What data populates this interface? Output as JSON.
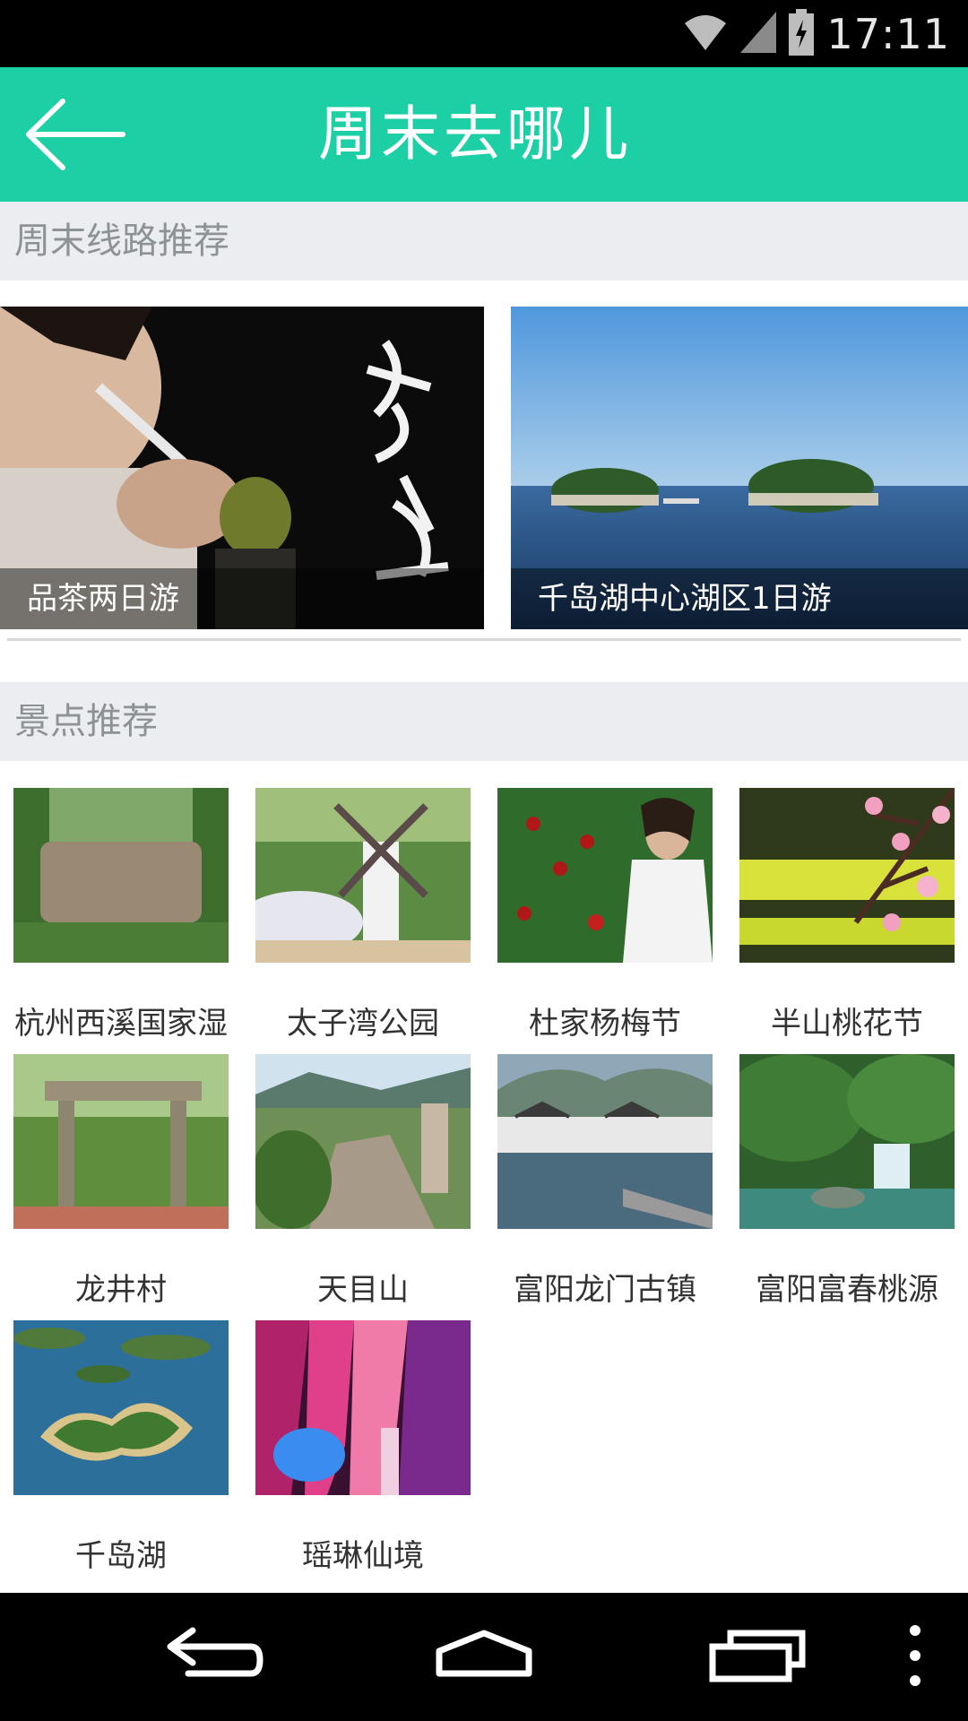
{
  "status_bar": {
    "time": "17:11"
  },
  "app_bar": {
    "title": "周末去哪儿"
  },
  "sections": {
    "routes_title": "周末线路推荐",
    "spots_title": "景点推荐"
  },
  "routes": [
    {
      "caption": "品茶两日游"
    },
    {
      "caption": "千岛湖中心湖区1日游"
    }
  ],
  "spots": [
    {
      "name": "杭州西溪国家湿"
    },
    {
      "name": "太子湾公园"
    },
    {
      "name": "杜家杨梅节"
    },
    {
      "name": "半山桃花节"
    },
    {
      "name": "龙井村"
    },
    {
      "name": "天目山"
    },
    {
      "name": "富阳龙门古镇"
    },
    {
      "name": "富阳富春桃源"
    },
    {
      "name": "千岛湖"
    },
    {
      "name": "瑶琳仙境"
    }
  ],
  "theme": {
    "accent": "#1ccfa4"
  },
  "icons": [
    "wifi-icon",
    "signal-icon",
    "battery-icon",
    "back-arrow-icon",
    "nav-back-icon",
    "nav-home-icon",
    "nav-recents-icon",
    "nav-menu-icon"
  ]
}
